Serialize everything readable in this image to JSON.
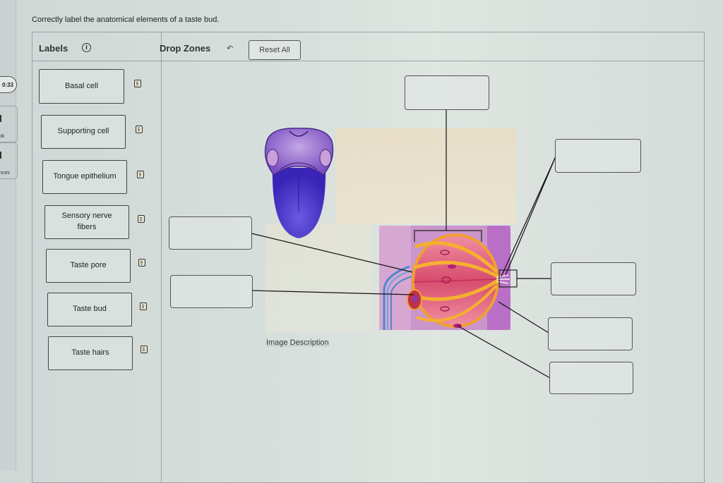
{
  "instruction": "Correctly label the anatomical elements of a taste bud.",
  "left_rail": {
    "timer": "0:33",
    "items": [
      {
        "label": "ok"
      },
      {
        "label": "nces"
      }
    ]
  },
  "labels_panel": {
    "title": "Labels",
    "info_icon": "info-icon",
    "items": [
      {
        "label": "Basal cell",
        "icon": "note-icon"
      },
      {
        "label": "Supporting cell",
        "icon": "note-icon"
      },
      {
        "label": "Tongue epithelium",
        "icon": "note-icon"
      },
      {
        "label": "Sensory nerve fibers",
        "icon": "note-icon"
      },
      {
        "label": "Taste pore",
        "icon": "note-icon"
      },
      {
        "label": "Taste bud",
        "icon": "note-icon"
      },
      {
        "label": "Taste hairs",
        "icon": "note-icon"
      }
    ]
  },
  "drop_zones_panel": {
    "title": "Drop Zones",
    "undo_icon": "undo-arrow-icon",
    "reset_label": "Reset All",
    "zones": [
      {
        "id": "top",
        "value": ""
      },
      {
        "id": "upper-right",
        "value": ""
      },
      {
        "id": "left-upper",
        "value": ""
      },
      {
        "id": "left-lower",
        "value": ""
      },
      {
        "id": "right-middle",
        "value": ""
      },
      {
        "id": "right-lower",
        "value": ""
      },
      {
        "id": "bottom-right",
        "value": ""
      }
    ],
    "image_description_link": "Image Description"
  },
  "colors": {
    "tongue": "#4a35c8",
    "taste_bud_cells": "#e0607a",
    "supporting_cell_outline": "#f2a020",
    "epithelium": "#b877c4",
    "nerve": "#5a8fd0"
  }
}
